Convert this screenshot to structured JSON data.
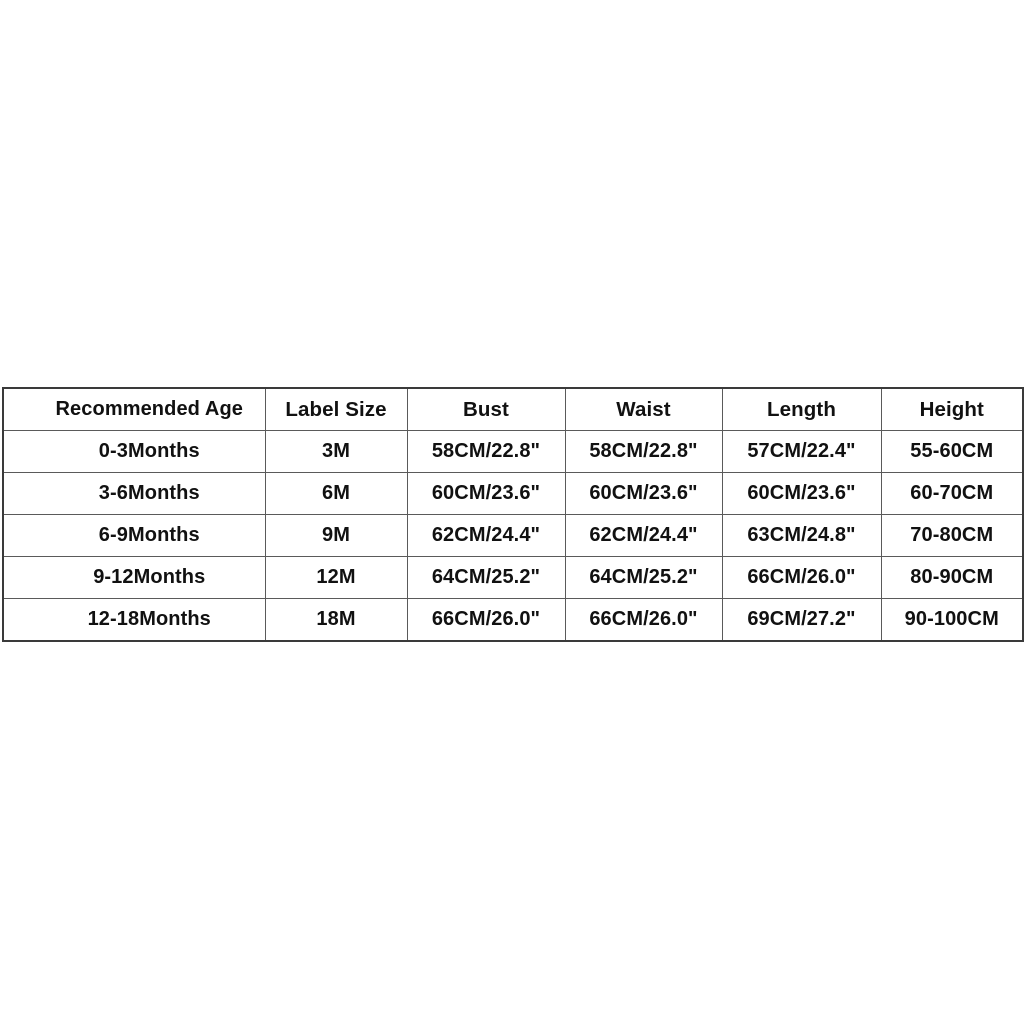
{
  "table": {
    "name": "baby-clothing-size-chart",
    "columns": [
      {
        "key": "age",
        "label": "Recommended Age"
      },
      {
        "key": "label",
        "label": "Label Size"
      },
      {
        "key": "bust",
        "label": "Bust"
      },
      {
        "key": "waist",
        "label": "Waist"
      },
      {
        "key": "length",
        "label": "Length"
      },
      {
        "key": "height",
        "label": "Height"
      }
    ],
    "rows": [
      {
        "age": "0-3Months",
        "label": "3M",
        "bust": "58CM/22.8\"",
        "waist": "58CM/22.8\"",
        "length": "57CM/22.4\"",
        "height": "55-60CM"
      },
      {
        "age": "3-6Months",
        "label": "6M",
        "bust": "60CM/23.6\"",
        "waist": "60CM/23.6\"",
        "length": "60CM/23.6\"",
        "height": "60-70CM"
      },
      {
        "age": "6-9Months",
        "label": "9M",
        "bust": "62CM/24.4\"",
        "waist": "62CM/24.4\"",
        "length": "63CM/24.8\"",
        "height": "70-80CM"
      },
      {
        "age": "9-12Months",
        "label": "12M",
        "bust": "64CM/25.2\"",
        "waist": "64CM/25.2\"",
        "length": "66CM/26.0\"",
        "height": "80-90CM"
      },
      {
        "age": "12-18Months",
        "label": "18M",
        "bust": "66CM/26.0\"",
        "waist": "66CM/26.0\"",
        "length": "69CM/27.2\"",
        "height": "90-100CM"
      }
    ]
  },
  "colors": {
    "page_background": "#ffffff",
    "cell_background": "#ffffff",
    "text": "#111111",
    "inner_border": "#5a5a5a",
    "outer_border": "#3a3a3a"
  }
}
